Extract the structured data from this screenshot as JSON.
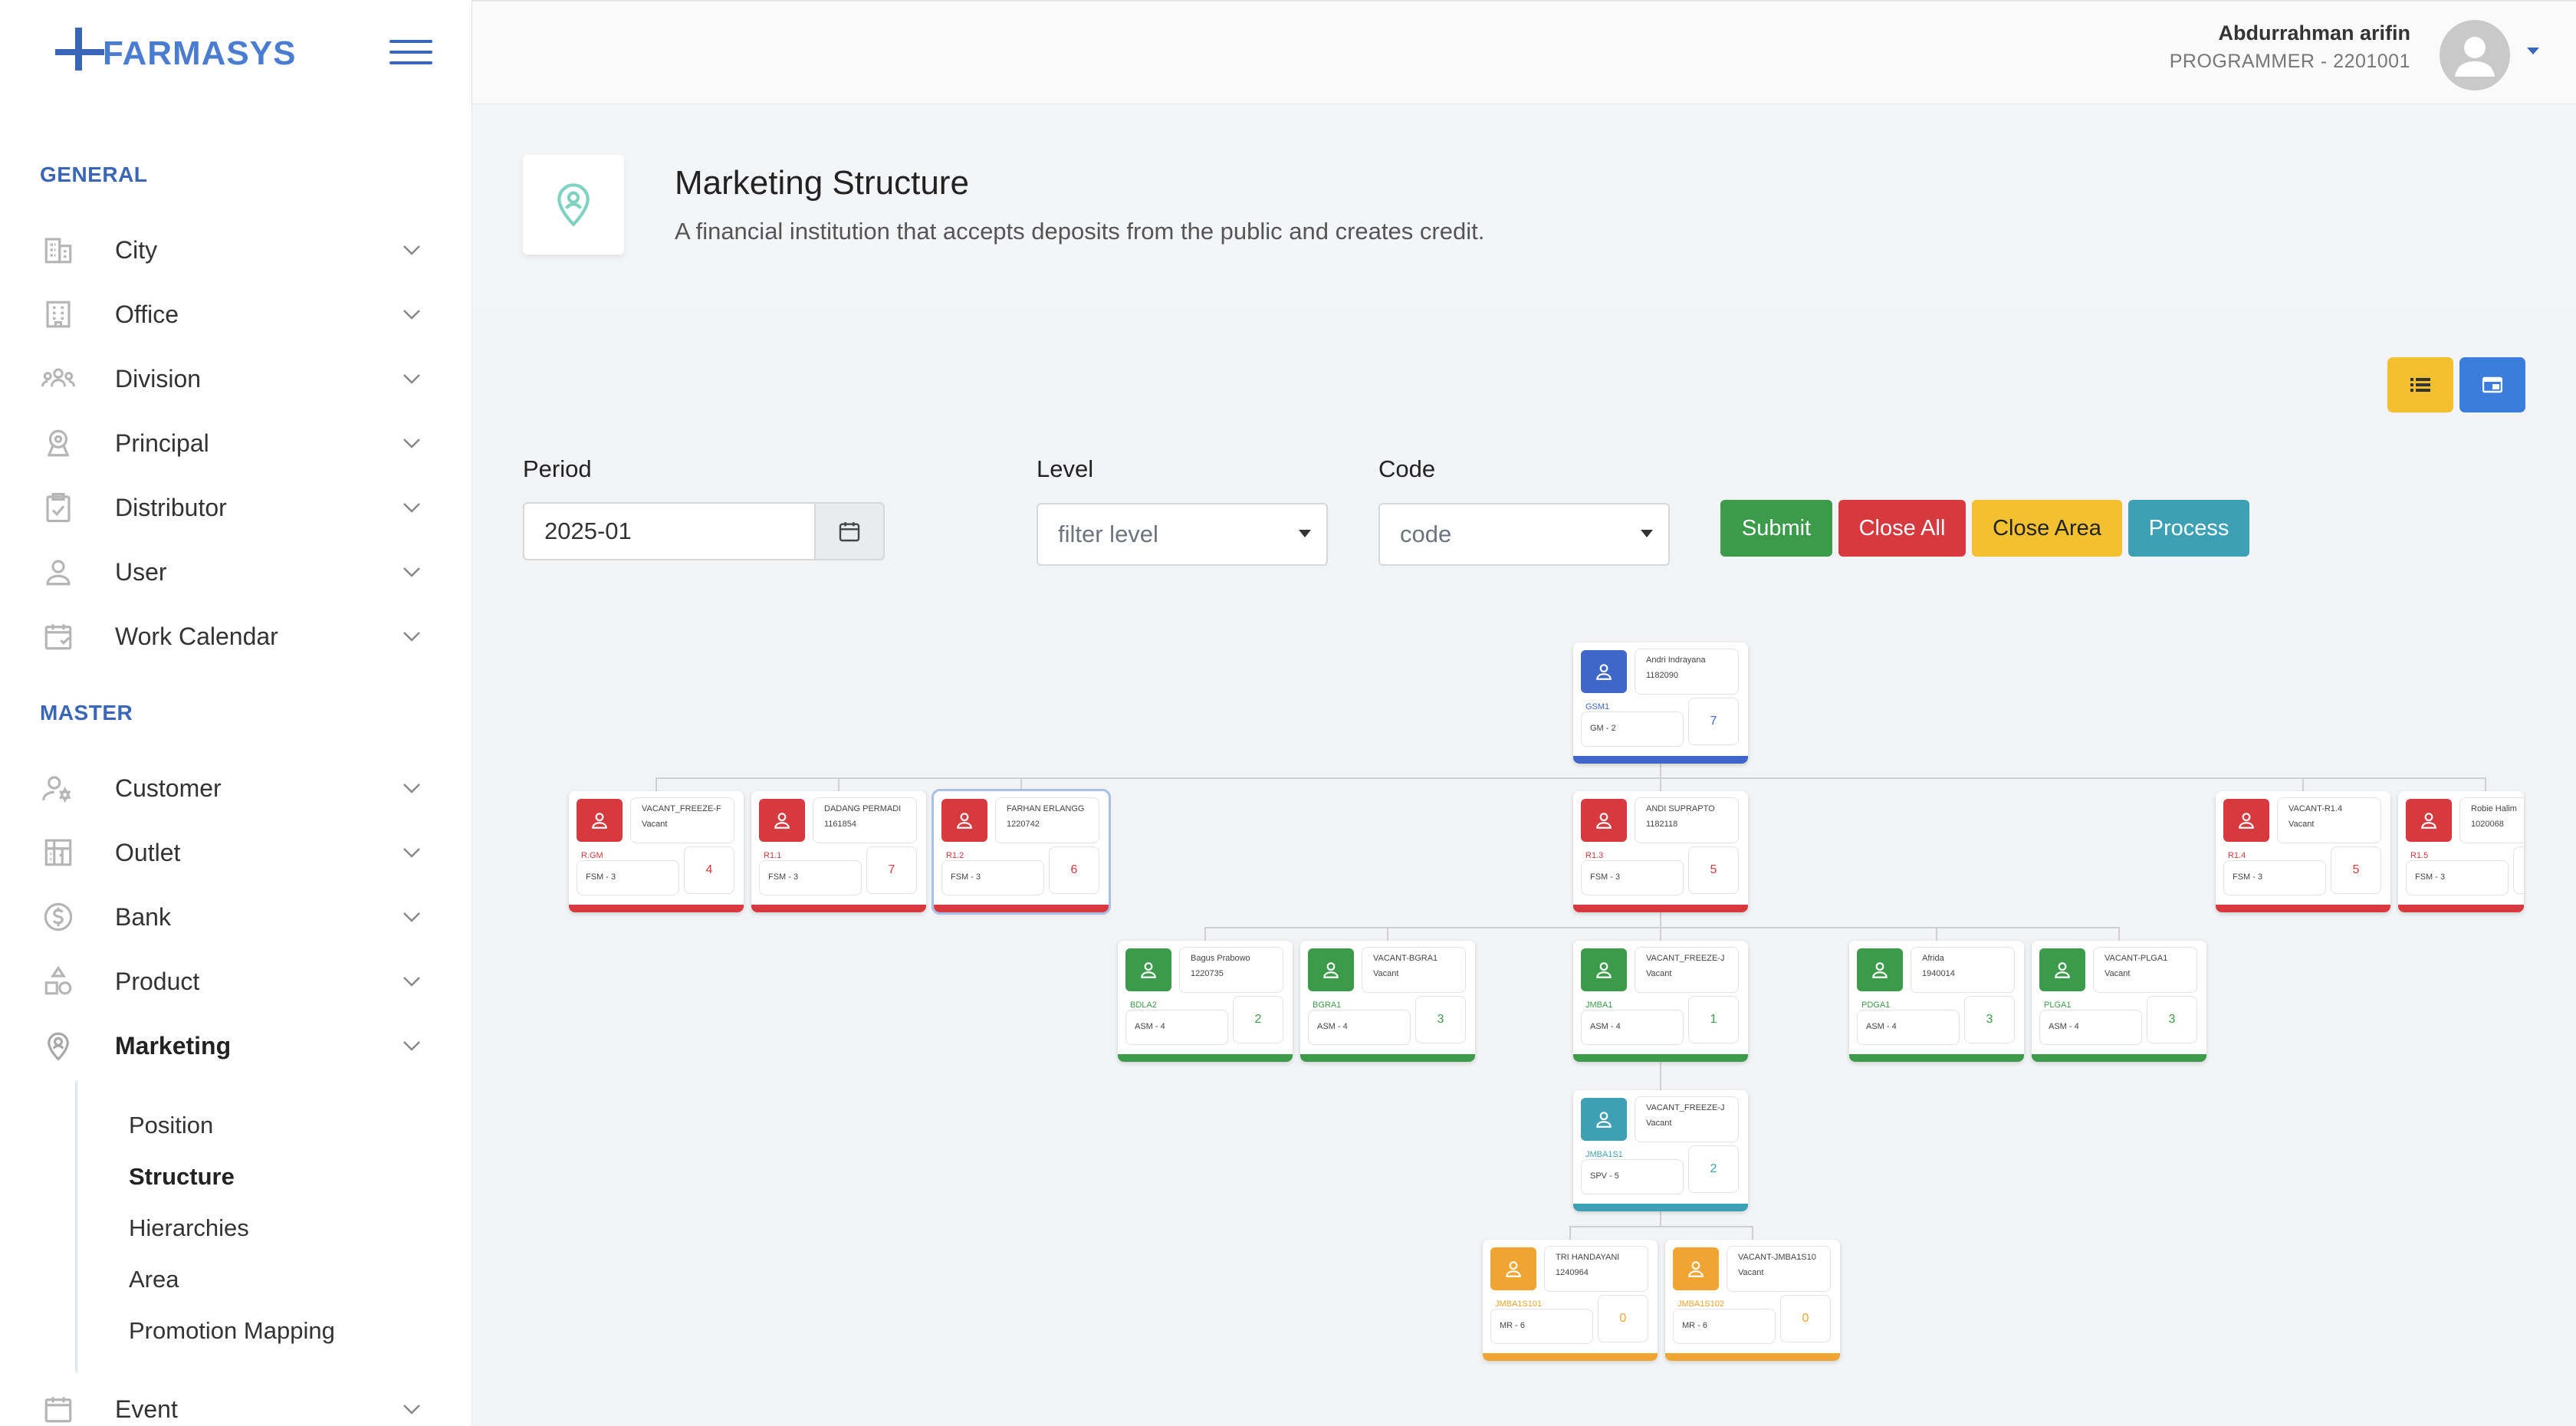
{
  "brand": {
    "name": "FARMASYS"
  },
  "sidebar": {
    "general_label": "GENERAL",
    "master_label": "MASTER",
    "general_items": [
      {
        "label": "City",
        "icon": "building-icon"
      },
      {
        "label": "Office",
        "icon": "office-icon"
      },
      {
        "label": "Division",
        "icon": "people-icon"
      },
      {
        "label": "Principal",
        "icon": "principal-icon"
      },
      {
        "label": "Distributor",
        "icon": "clipboard-icon"
      },
      {
        "label": "User",
        "icon": "user-icon"
      },
      {
        "label": "Work Calendar",
        "icon": "calendar-icon"
      }
    ],
    "master_items": [
      {
        "label": "Customer",
        "icon": "customer-icon"
      },
      {
        "label": "Outlet",
        "icon": "outlet-icon"
      },
      {
        "label": "Bank",
        "icon": "dollar-icon"
      },
      {
        "label": "Product",
        "icon": "shapes-icon"
      },
      {
        "label": "Marketing",
        "icon": "marketing-icon"
      }
    ],
    "marketing_sub": [
      "Position",
      "Structure",
      "Hierarchies",
      "Area",
      "Promotion Mapping"
    ],
    "event_label": "Event"
  },
  "header": {
    "user_name": "Abdurrahman arifin",
    "user_role": "PROGRAMMER - 2201001"
  },
  "page": {
    "title": "Marketing Structure",
    "subtitle": "A financial institution that accepts deposits from the public and creates credit."
  },
  "filters": {
    "period_label": "Period",
    "period_value": "2025-01",
    "level_label": "Level",
    "level_placeholder": "filter level",
    "code_label": "Code",
    "code_placeholder": "code"
  },
  "buttons": {
    "submit": "Submit",
    "close_all": "Close All",
    "close_area": "Close Area",
    "process": "Process"
  },
  "colors": {
    "blue": "#3f67c9",
    "red": "#d63a3f",
    "green": "#3c9b4a",
    "teal": "#3ea0b4",
    "orange": "#f0a431",
    "yellow": "#f3c02f",
    "primary": "#3b7ddd"
  },
  "org_nodes": [
    {
      "id": "gm",
      "name": "Andri Indrayana",
      "nid": "1182090",
      "code": "GSM1",
      "pos": "GM - 2",
      "count": "7",
      "color": "blue"
    },
    {
      "id": "f1",
      "name": "VACANT_FREEZE-F",
      "nid": "Vacant",
      "code": "R.GM",
      "pos": "FSM - 3",
      "count": "4",
      "color": "red"
    },
    {
      "id": "f2",
      "name": "DADANG PERMADI",
      "nid": "1161854",
      "code": "R1.1",
      "pos": "FSM - 3",
      "count": "7",
      "color": "red"
    },
    {
      "id": "f3",
      "name": "FARHAN ERLANGG",
      "nid": "1220742",
      "code": "R1.2",
      "pos": "FSM - 3",
      "count": "6",
      "color": "red"
    },
    {
      "id": "f4",
      "name": "ANDI SUPRAPTO",
      "nid": "1182118",
      "code": "R1.3",
      "pos": "FSM - 3",
      "count": "5",
      "color": "red"
    },
    {
      "id": "f5",
      "name": "VACANT-R1.4",
      "nid": "Vacant",
      "code": "R1.4",
      "pos": "FSM - 3",
      "count": "5",
      "color": "red"
    },
    {
      "id": "f6",
      "name": "Robie Halim",
      "nid": "1020068",
      "code": "R1.5",
      "pos": "FSM - 3",
      "count": "",
      "color": "red"
    },
    {
      "id": "a1",
      "name": "Bagus Prabowo",
      "nid": "1220735",
      "code": "BDLA2",
      "pos": "ASM - 4",
      "count": "2",
      "color": "green"
    },
    {
      "id": "a2",
      "name": "VACANT-BGRA1",
      "nid": "Vacant",
      "code": "BGRA1",
      "pos": "ASM - 4",
      "count": "3",
      "color": "green"
    },
    {
      "id": "a3",
      "name": "VACANT_FREEZE-J",
      "nid": "Vacant",
      "code": "JMBA1",
      "pos": "ASM - 4",
      "count": "1",
      "color": "green"
    },
    {
      "id": "a4",
      "name": "Afrida",
      "nid": "1940014",
      "code": "PDGA1",
      "pos": "ASM - 4",
      "count": "3",
      "color": "green"
    },
    {
      "id": "a5",
      "name": "VACANT-PLGA1",
      "nid": "Vacant",
      "code": "PLGA1",
      "pos": "ASM - 4",
      "count": "3",
      "color": "green"
    },
    {
      "id": "s1",
      "name": "VACANT_FREEZE-J",
      "nid": "Vacant",
      "code": "JMBA1S1",
      "pos": "SPV - 5",
      "count": "2",
      "color": "teal"
    },
    {
      "id": "m1",
      "name": "TRI HANDAYANI",
      "nid": "1240964",
      "code": "JMBA1S101",
      "pos": "MR - 6",
      "count": "0",
      "color": "orange"
    },
    {
      "id": "m2",
      "name": "VACANT-JMBA1S10",
      "nid": "Vacant",
      "code": "JMBA1S102",
      "pos": "MR - 6",
      "count": "0",
      "color": "orange"
    }
  ]
}
